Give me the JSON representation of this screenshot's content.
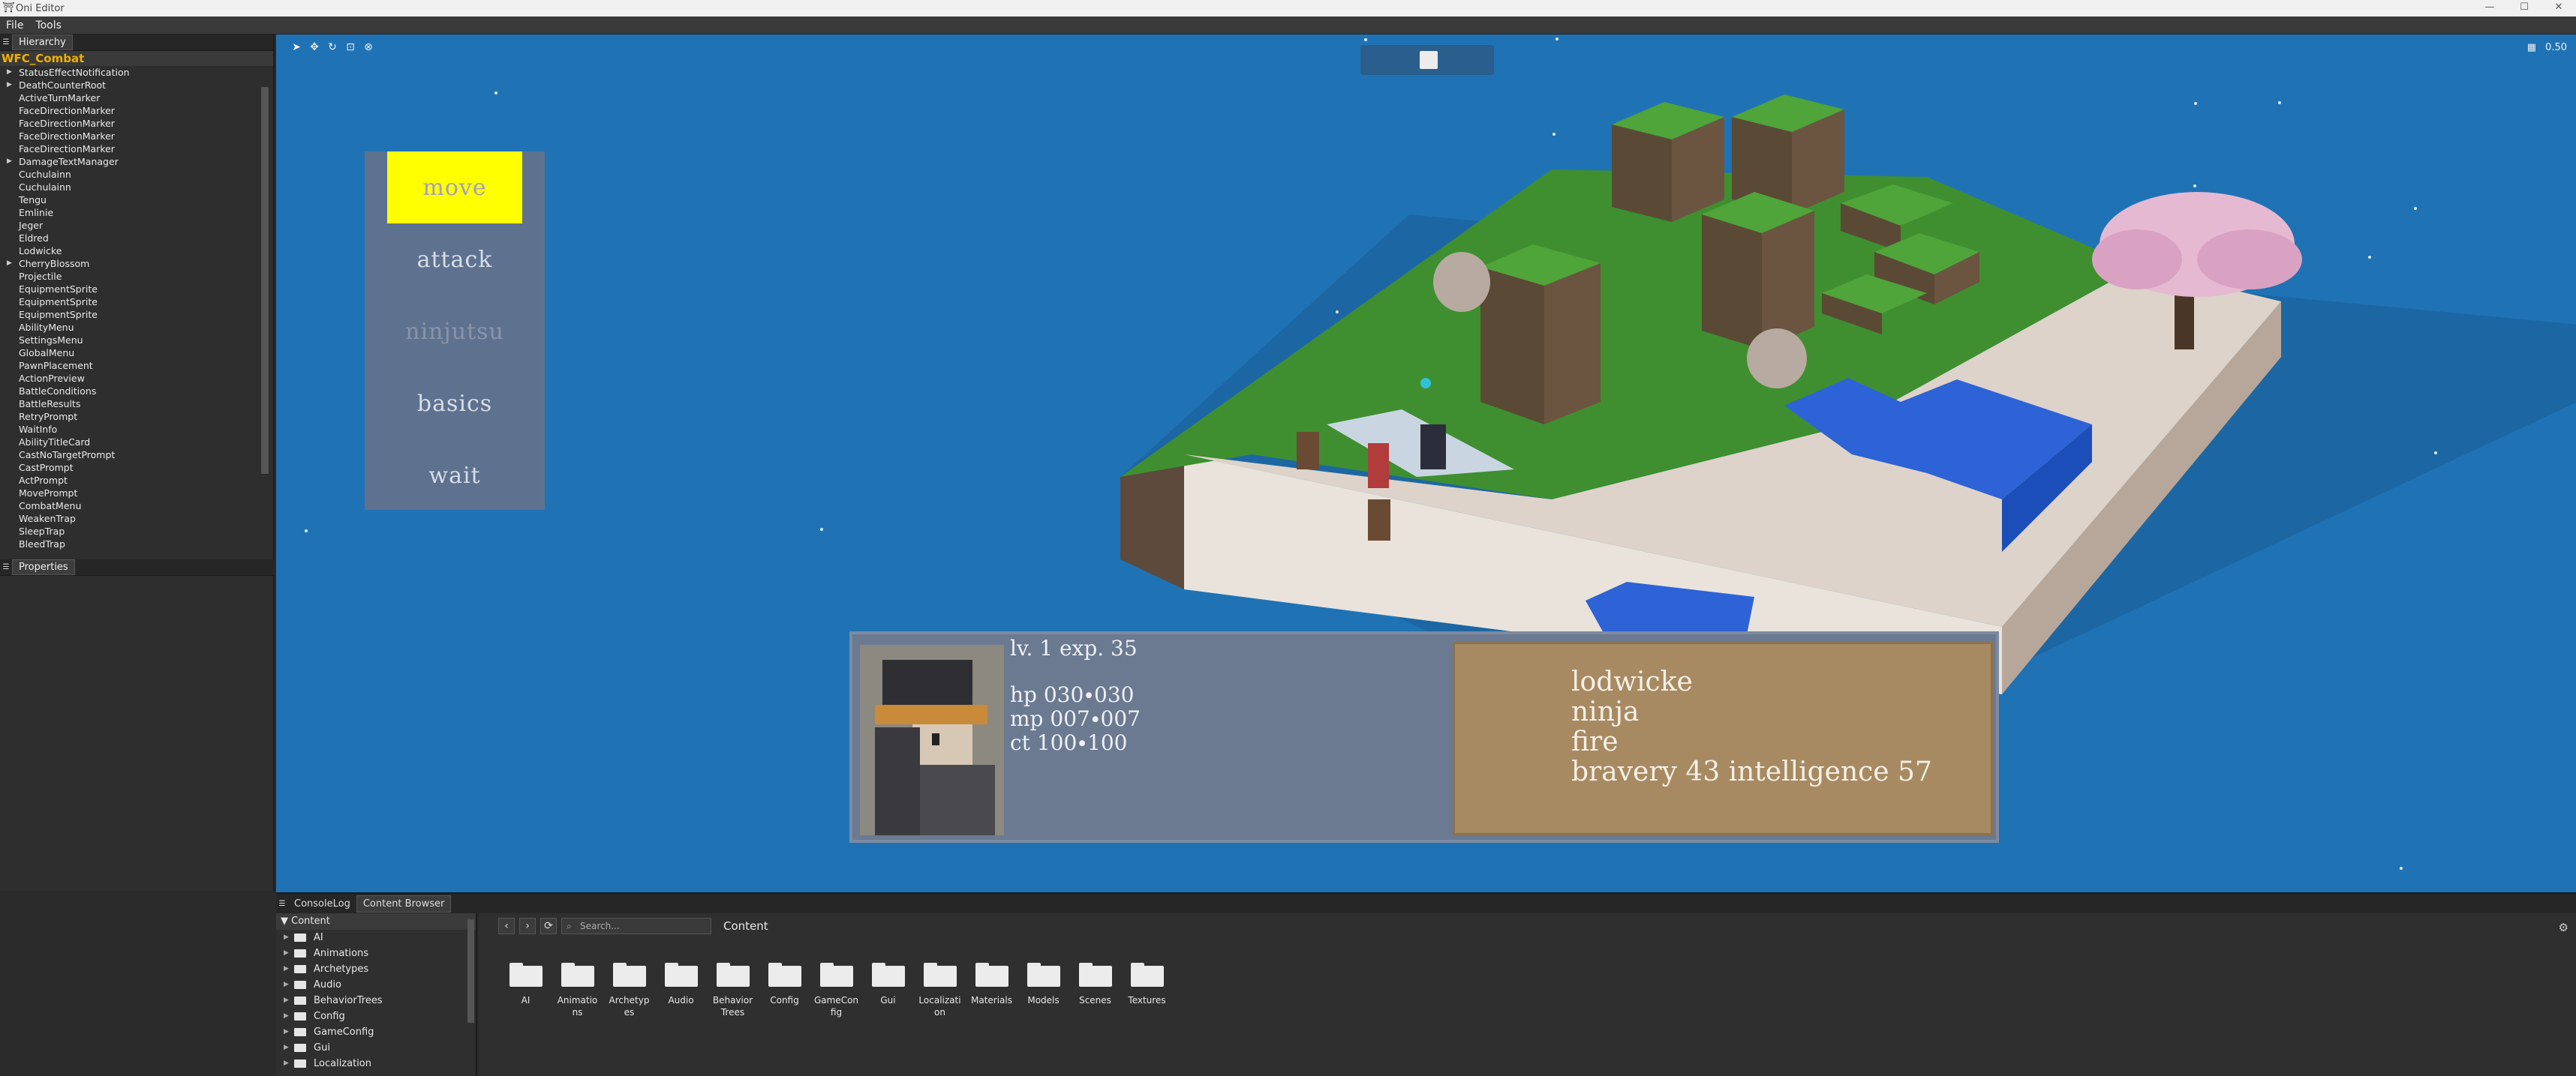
{
  "window": {
    "title": "Oni Editor",
    "minimize": "—",
    "maximize": "☐",
    "close": "✕"
  },
  "menubar": {
    "file": "File",
    "tools": "Tools"
  },
  "hierarchy": {
    "tab_label": "Hierarchy",
    "scene_root": "WFC_Combat",
    "items": [
      {
        "label": "StatusEffectNotification",
        "expandable": true
      },
      {
        "label": "DeathCounterRoot",
        "expandable": true
      },
      {
        "label": "ActiveTurnMarker",
        "expandable": false
      },
      {
        "label": "FaceDirectionMarker",
        "expandable": false
      },
      {
        "label": "FaceDirectionMarker",
        "expandable": false
      },
      {
        "label": "FaceDirectionMarker",
        "expandable": false
      },
      {
        "label": "FaceDirectionMarker",
        "expandable": false
      },
      {
        "label": "DamageTextManager",
        "expandable": true
      },
      {
        "label": "Cuchulainn",
        "expandable": false
      },
      {
        "label": "Cuchulainn",
        "expandable": false
      },
      {
        "label": "Tengu",
        "expandable": false
      },
      {
        "label": "Emlinie",
        "expandable": false
      },
      {
        "label": "Jeger",
        "expandable": false
      },
      {
        "label": "Eldred",
        "expandable": false
      },
      {
        "label": "Lodwicke",
        "expandable": false
      },
      {
        "label": "CherryBlossom",
        "expandable": true
      },
      {
        "label": "Projectile",
        "expandable": false
      },
      {
        "label": "EquipmentSprite",
        "expandable": false
      },
      {
        "label": "EquipmentSprite",
        "expandable": false
      },
      {
        "label": "EquipmentSprite",
        "expandable": false
      },
      {
        "label": "AbilityMenu",
        "expandable": false
      },
      {
        "label": "SettingsMenu",
        "expandable": false
      },
      {
        "label": "GlobalMenu",
        "expandable": false
      },
      {
        "label": "PawnPlacement",
        "expandable": false
      },
      {
        "label": "ActionPreview",
        "expandable": false
      },
      {
        "label": "BattleConditions",
        "expandable": false
      },
      {
        "label": "BattleResults",
        "expandable": false
      },
      {
        "label": "RetryPrompt",
        "expandable": false
      },
      {
        "label": "WaitInfo",
        "expandable": false
      },
      {
        "label": "AbilityTitleCard",
        "expandable": false
      },
      {
        "label": "CastNoTargetPrompt",
        "expandable": false
      },
      {
        "label": "CastPrompt",
        "expandable": false
      },
      {
        "label": "ActPrompt",
        "expandable": false
      },
      {
        "label": "MovePrompt",
        "expandable": false
      },
      {
        "label": "CombatMenu",
        "expandable": false
      },
      {
        "label": "WeakenTrap",
        "expandable": false
      },
      {
        "label": "SleepTrap",
        "expandable": false
      },
      {
        "label": "BleedTrap",
        "expandable": false
      }
    ]
  },
  "properties": {
    "tab_label": "Properties"
  },
  "viewport": {
    "zoom": "0.50",
    "game_menu": [
      {
        "label": "move",
        "state": "selected"
      },
      {
        "label": "attack",
        "state": "normal"
      },
      {
        "label": "ninjutsu",
        "state": "disabled"
      },
      {
        "label": "basics",
        "state": "normal"
      },
      {
        "label": "wait",
        "state": "normal"
      }
    ],
    "unit_info": {
      "level_line": "lv. 1 exp. 35",
      "hp": "hp 030∙030",
      "mp": "mp 007∙007",
      "ct": "ct 100∙100",
      "name": "lodwicke",
      "job": "ninja",
      "element": "fire",
      "traits": "bravery 43 intelligence 57"
    }
  },
  "dock": {
    "tabs": [
      "ConsoleLog",
      "Content Browser"
    ],
    "active_tab": "Content Browser"
  },
  "content_browser": {
    "tree_root": "Content",
    "tree_items": [
      "AI",
      "Animations",
      "Archetypes",
      "Audio",
      "BehaviorTrees",
      "Config",
      "GameConfig",
      "Gui",
      "Localization"
    ],
    "search_placeholder": "Search...",
    "path": "Content",
    "folders": [
      "AI",
      "Animations",
      "Archetypes",
      "Audio",
      "Behavior Trees",
      "Config",
      "GameConfig",
      "Gui",
      "Localization",
      "Materials",
      "Models",
      "Scenes",
      "Textures"
    ]
  },
  "colors": {
    "sky": "#1f73b5",
    "menu_panel": "#5e7290",
    "menu_selected": "#ffff00",
    "info_panel": "#6b7a91",
    "name_box": "#a88a62",
    "scene_root_text": "#f0b000"
  }
}
